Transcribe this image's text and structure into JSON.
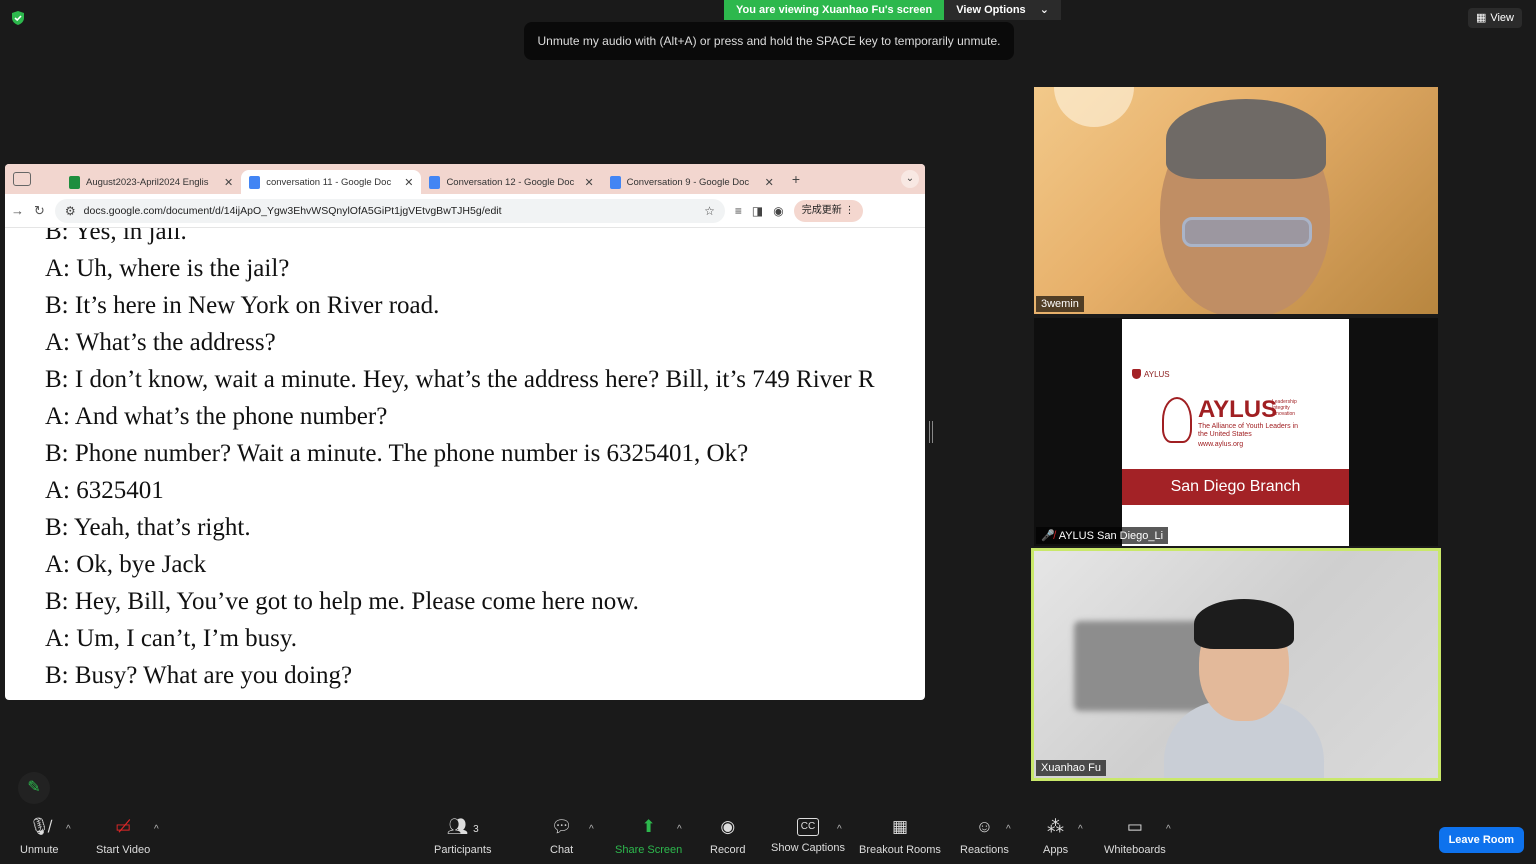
{
  "banner": {
    "viewing_text": "You are viewing Xuanhao Fu's screen",
    "view_options_label": "View Options"
  },
  "toast": {
    "text": "Unmute my audio with (Alt+A) or press and hold the SPACE key to temporarily unmute."
  },
  "view_button_label": "View",
  "browser": {
    "tabs": [
      {
        "label": "August2023-April2024 Englis",
        "icon_color": "#1e8e3e"
      },
      {
        "label": "conversation 11 - Google Doc",
        "icon_color": "#4285f4"
      },
      {
        "label": "Conversation 12 - Google Doc",
        "icon_color": "#4285f4"
      },
      {
        "label": "Conversation 9 - Google Doc",
        "icon_color": "#4285f4"
      }
    ],
    "url": "docs.google.com/document/d/14ijApO_Ygw3EhvWSQnylOfA5GiPt1jgVEtvgBwTJH5g/edit",
    "update_label": "完成更新"
  },
  "document": {
    "lines": [
      "B: Yes, in jail.",
      "A: Uh, where is the jail?",
      "B: It’s here in New York on River road.",
      "A: What’s the address?",
      "B: I don’t know, wait a minute. Hey, what’s the address here? Bill, it’s 749 River R",
      "A: And what’s the phone number?",
      "B: Phone number? Wait a minute. The phone number is 6325401, Ok?",
      "A: 6325401",
      "B: Yeah, that’s right.",
      "A: Ok, bye Jack",
      "B: Hey, Bill, You’ve got to help me. Please come here now.",
      "A: Um, I can’t, I’m busy.",
      "B: Busy? What are you doing?"
    ]
  },
  "participants": [
    {
      "name": "3wemin"
    },
    {
      "name": "AYLUS San Diego_Li",
      "muted": true
    },
    {
      "name": "Xuanhao Fu"
    }
  ],
  "aylus_card": {
    "small_brand": "AYLUS",
    "brand": "AYLUS",
    "tagline": "The Alliance of Youth Leaders in the United States",
    "url": "www.aylus.org",
    "values": [
      "Leadership",
      "Integrity",
      "Innovation"
    ],
    "branch": "San Diego Branch"
  },
  "toolbar": {
    "unmute": "Unmute",
    "start_video": "Start Video",
    "participants": "Participants",
    "participants_count": "3",
    "chat": "Chat",
    "share_screen": "Share Screen",
    "record": "Record",
    "show_captions": "Show Captions",
    "breakout_rooms": "Breakout Rooms",
    "reactions": "Reactions",
    "apps": "Apps",
    "whiteboards": "Whiteboards",
    "leave_room": "Leave Room"
  },
  "colors": {
    "accent_green": "#2db84d",
    "leave_blue": "#0e72ed",
    "active_speaker": "#c9e86a",
    "aylus_red": "#a32226"
  }
}
